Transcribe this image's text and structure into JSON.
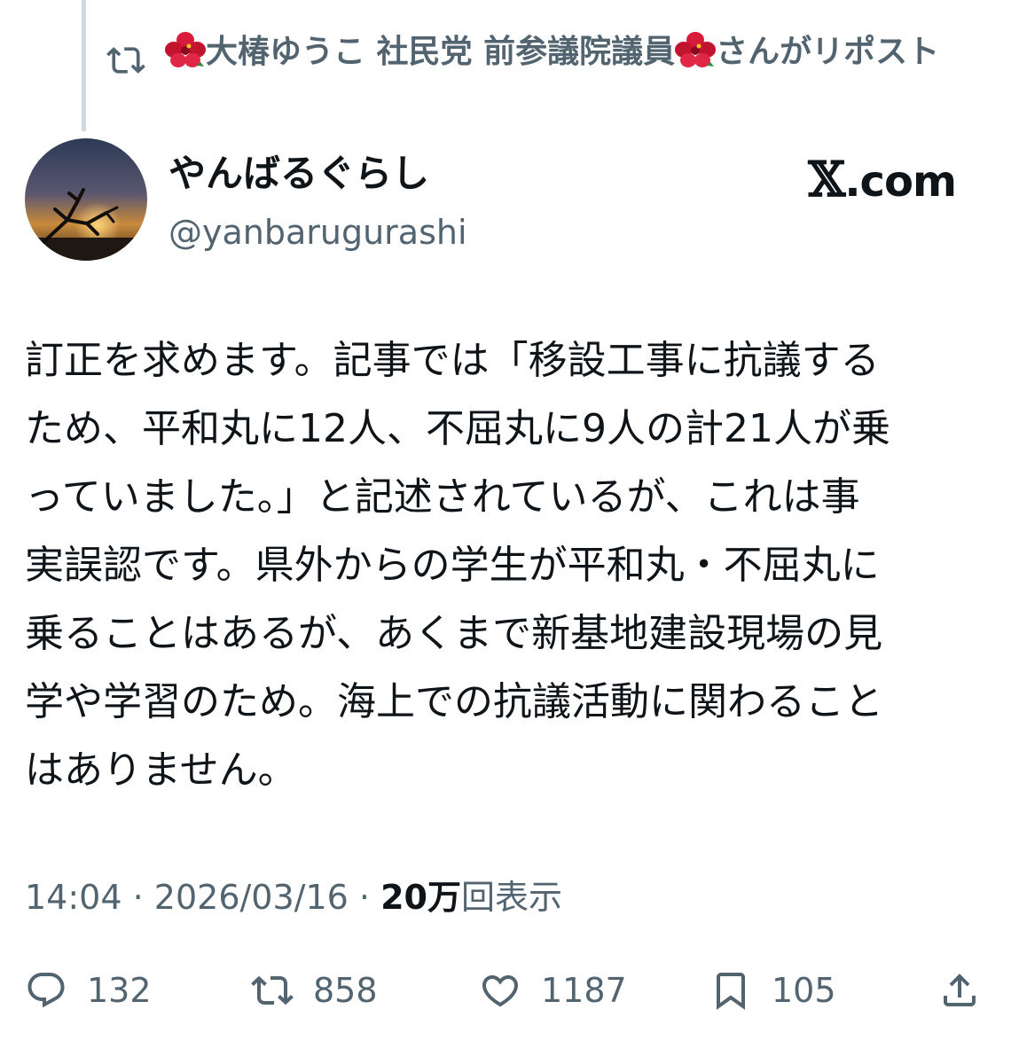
{
  "repost_banner": {
    "text_before": "大椿ゆうこ 社民党 前参議院議員",
    "text_after": "さんがリポスト",
    "icon": "repost-icon",
    "emoji": "hibiscus"
  },
  "author": {
    "display_name": "やんばるぐらし",
    "handle": "@yanbarugurashi",
    "avatar": "sunset-avatar"
  },
  "watermark": {
    "x_glyph": "𝕏",
    "domain": ".com"
  },
  "tweet": {
    "lines": [
      "訂正を求めます。記事では「移設工事に抗議する",
      "ため、平和丸に12人、不屈丸に9人の計21人が乗",
      "っていました。」と記述されているが、これは事",
      "実誤認です。県外からの学生が平和丸・不屈丸に",
      "乗ることはあるが、あくまで新基地建設現場の見",
      "学や学習のため。海上での抗議活動に関わること",
      "はありません。"
    ]
  },
  "meta": {
    "time": "14:04",
    "separator": "·",
    "date": "2026/03/16",
    "views_count": "20万",
    "views_label": "回表示"
  },
  "actions": {
    "reply": {
      "icon": "reply-icon",
      "count": "132"
    },
    "repost": {
      "icon": "repost-icon",
      "count": "858"
    },
    "like": {
      "icon": "heart-icon",
      "count": "1187"
    },
    "bookmark": {
      "icon": "bookmark-icon",
      "count": "105"
    },
    "share": {
      "icon": "share-icon"
    }
  },
  "colors": {
    "primary_text": "#0f1419",
    "secondary_text": "#536471",
    "thread_line": "#cfd9de",
    "hibiscus": "#d81b3a"
  }
}
